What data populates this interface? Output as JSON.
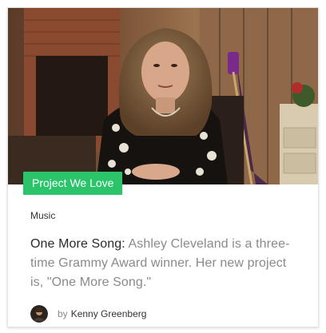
{
  "card": {
    "badge": "Project We Love",
    "category": "Music",
    "title": "One More Song:",
    "description": "Ashley Cleveland is a three-time Grammy Award winner. Her new project is, \"One More Song.\"",
    "by_label": "by",
    "author_name": "Kenny Greenberg"
  },
  "icons": {
    "avatar": "author-avatar-photo"
  },
  "colors": {
    "badge_bg": "#2bc46a",
    "title_text": "#2a2a2a",
    "description_text": "#8a8a8a"
  }
}
